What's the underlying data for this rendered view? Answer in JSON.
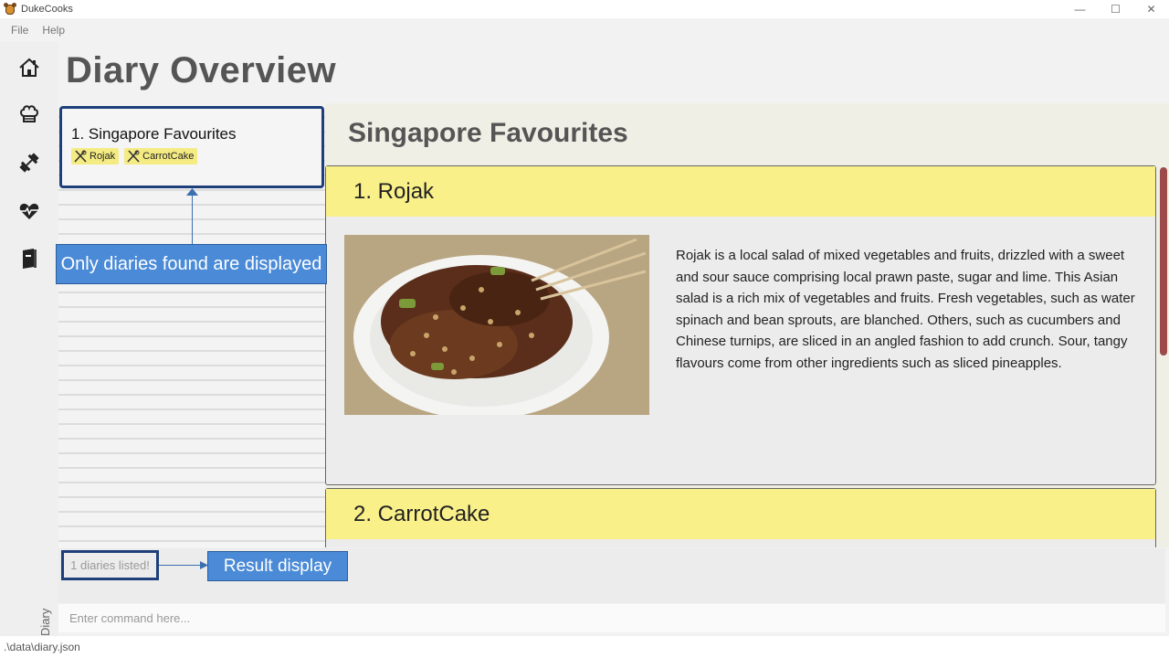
{
  "window": {
    "title": "DukeCooks",
    "minimize": "—",
    "maximize": "☐",
    "close": "✕"
  },
  "menu": {
    "items": [
      "File",
      "Help"
    ]
  },
  "sidebar": {
    "icons": [
      "home-icon",
      "chef-hat-icon",
      "dumbbell-icon",
      "heartbeat-icon",
      "diary-book-icon"
    ],
    "vertical_label": "Diary"
  },
  "page": {
    "title": "Diary Overview"
  },
  "diary_list": {
    "items": [
      {
        "title": "1.  Singapore Favourites",
        "tags": [
          "Rojak",
          "CarrotCake"
        ]
      }
    ]
  },
  "detail": {
    "title": "Singapore Favourites",
    "entries": [
      {
        "heading": "1. Rojak",
        "text": "Rojak is a local salad of mixed vegetables and fruits, drizzled with a sweet and sour sauce comprising local prawn paste, sugar and lime. This Asian salad is a rich mix of vegetables and fruits. Fresh vegetables, such as water spinach and bean sprouts, are blanched. Others, such as cucumbers and Chinese turnips, are sliced in an angled fashion to add crunch. Sour, tangy flavours come from other ingredients such as sliced pineapples."
      },
      {
        "heading": "2. CarrotCake"
      }
    ]
  },
  "result": {
    "text": "1 diaries listed!"
  },
  "command": {
    "placeholder": "Enter command here..."
  },
  "status": {
    "path": ".\\data\\diary.json"
  },
  "callouts": {
    "list_note": "Only diaries found are displayed",
    "result_note": "Result display"
  },
  "colors": {
    "accent_border": "#1e3f7a",
    "tag_bg": "#f5eb83",
    "entry_header": "#faf089",
    "callout": "#4a8ad6"
  }
}
